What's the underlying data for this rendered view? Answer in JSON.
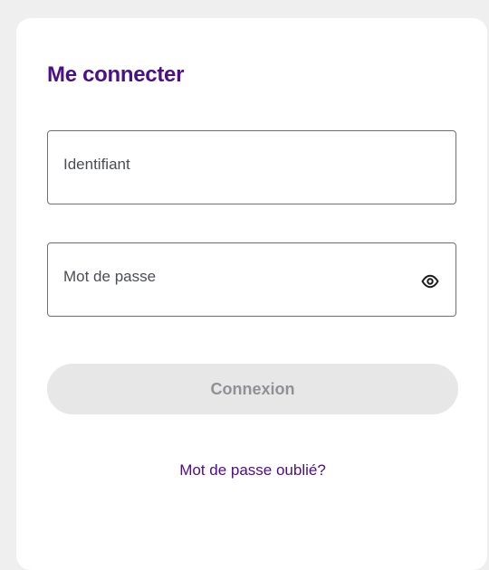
{
  "login": {
    "title": "Me connecter",
    "username": {
      "placeholder": "Identifiant",
      "value": ""
    },
    "password": {
      "placeholder": "Mot de passe",
      "value": "",
      "toggle_icon": "eye-icon"
    },
    "submit_label": "Connexion",
    "submit_state": "disabled",
    "forgot_password_label": "Mot de passe oublié?"
  },
  "colors": {
    "brand_purple": "#4b0f86",
    "page_background": "#efefef",
    "card_background": "#ffffff",
    "field_border": "#6d6f72",
    "disabled_button_bg": "#e7e7e8",
    "disabled_button_text": "#8f9195"
  }
}
